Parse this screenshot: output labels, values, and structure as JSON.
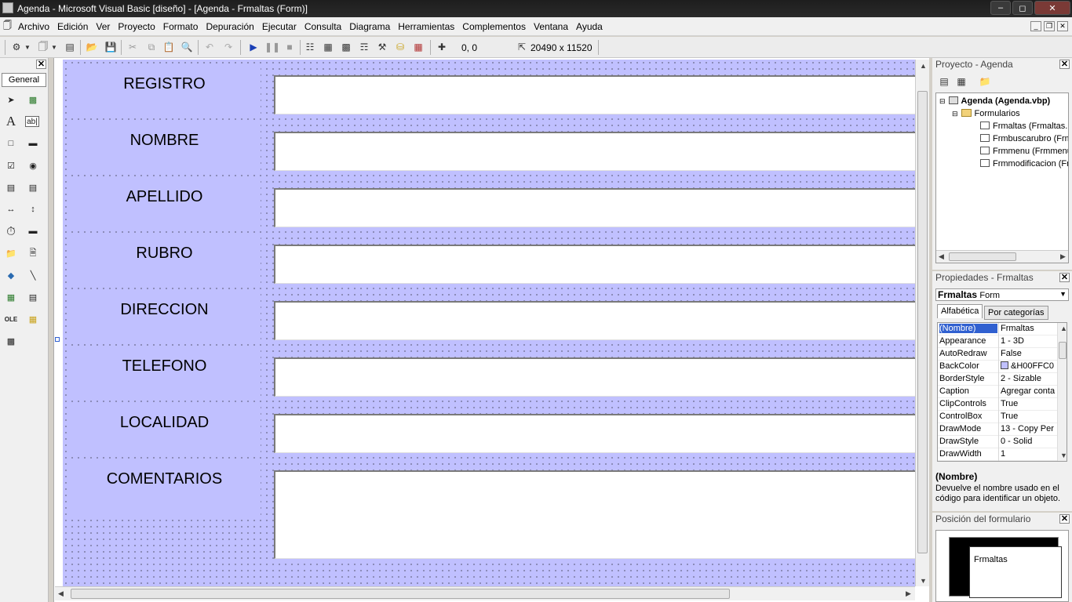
{
  "window": {
    "title": "Agenda - Microsoft Visual Basic [diseño] - [Agenda - Frmaltas (Form)]"
  },
  "menu": [
    "Archivo",
    "Edición",
    "Ver",
    "Proyecto",
    "Formato",
    "Depuración",
    "Ejecutar",
    "Consulta",
    "Diagrama",
    "Herramientas",
    "Complementos",
    "Ventana",
    "Ayuda"
  ],
  "toolbar": {
    "position": "0, 0",
    "size": "20490 x 11520"
  },
  "toolbox": {
    "tab": "General"
  },
  "form": {
    "fields": [
      "REGISTRO",
      "NOMBRE",
      "APELLIDO",
      "RUBRO",
      "DIRECCION",
      "TELEFONO",
      "LOCALIDAD",
      "COMENTARIOS"
    ]
  },
  "project": {
    "title": "Proyecto - Agenda",
    "root": "Agenda (Agenda.vbp)",
    "folder": "Formularios",
    "items": [
      "Frmaltas (Frmaltas.",
      "Frmbuscarubro (Frm",
      "Frmmenu (Frmmenu",
      "Frmmodificacion (Fr"
    ]
  },
  "properties": {
    "title": "Propiedades - Frmaltas",
    "object_name": "Frmaltas",
    "object_type": "Form",
    "tabs": [
      "Alfabética",
      "Por categorías"
    ],
    "rows": [
      {
        "name": "(Nombre)",
        "value": "Frmaltas"
      },
      {
        "name": "Appearance",
        "value": "1 - 3D"
      },
      {
        "name": "AutoRedraw",
        "value": "False"
      },
      {
        "name": "BackColor",
        "value": "&H00FFC0"
      },
      {
        "name": "BorderStyle",
        "value": "2 - Sizable"
      },
      {
        "name": "Caption",
        "value": "Agregar conta"
      },
      {
        "name": "ClipControls",
        "value": "True"
      },
      {
        "name": "ControlBox",
        "value": "True"
      },
      {
        "name": "DrawMode",
        "value": "13 - Copy Per"
      },
      {
        "name": "DrawStyle",
        "value": "0 - Solid"
      },
      {
        "name": "DrawWidth",
        "value": "1"
      }
    ],
    "desc_title": "(Nombre)",
    "desc_text": "Devuelve el nombre usado en el código para identificar un objeto."
  },
  "position_panel": {
    "title": "Posición del formulario",
    "preview_label": "Frmaltas"
  },
  "colors": {
    "form_back": "#c0c0ff",
    "backcolor_swatch": "#c0c0ff"
  }
}
